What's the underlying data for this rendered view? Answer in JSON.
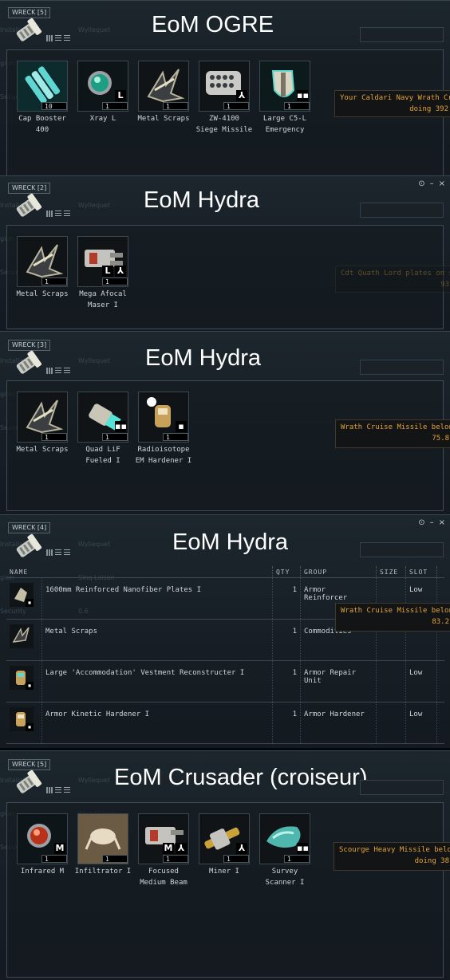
{
  "bg": {
    "l1": "Wyllequet",
    "l2": "Sinq Laison",
    "l3": "0.6",
    "c1": "Installation",
    "c2": "gion",
    "c3": "Security"
  },
  "panels": [
    {
      "wreck_label": "WRECK [5]",
      "title": "EoM OGRE",
      "items": [
        {
          "name": "Cap Booster\n400",
          "qty": "10",
          "icon": "cap-booster-icon"
        },
        {
          "name": "Xray L",
          "qty": "1",
          "badge": "L",
          "icon": "xray-crystal-icon"
        },
        {
          "name": "Metal Scraps",
          "qty": "1",
          "icon": "metal-scraps-icon"
        },
        {
          "name": "ZW-4100\nSiege Missile",
          "qty": "1",
          "badge": "⅄",
          "icon": "siege-launcher-icon"
        },
        {
          "name": "Large C5-L\nEmergency",
          "qty": "1",
          "badge": "▪▪",
          "icon": "emergency-shield-icon"
        }
      ],
      "notification": [
        "Your Caldari Navy Wrath Cru",
        "doing 392"
      ]
    },
    {
      "wreck_label": "WRECK [2]",
      "title": "EoM Hydra",
      "items": [
        {
          "name": "Metal Scraps",
          "qty": "1",
          "icon": "metal-scraps-icon"
        },
        {
          "name": "Mega Afocal\nMaser I",
          "qty": "1",
          "badge": "L",
          "badge2": "⅄",
          "icon": "mega-maser-icon"
        }
      ],
      "notification": [
        "Cdt Quath Lord plates on se",
        "93"
      ]
    },
    {
      "wreck_label": "WRECK [3]",
      "title": "EoM Hydra",
      "items": [
        {
          "name": "Metal Scraps",
          "qty": "1",
          "icon": "metal-scraps-icon"
        },
        {
          "name": "Quad LiF\nFueled I",
          "qty": "1",
          "badge": "▪▪",
          "icon": "booster-thruster-icon"
        },
        {
          "name": "Radioisotope\nEM Hardener I",
          "qty": "1",
          "badge": "▪",
          "icon": "em-hardener-icon"
        }
      ],
      "notification": [
        "Wrath Cruise Missile belongin",
        "75.8"
      ]
    },
    {
      "wreck_label": "WRECK [4]",
      "title": "EoM Hydra",
      "columns": [
        "NAME",
        "QTY",
        "GROUP",
        "SIZE",
        "SLOT"
      ],
      "rows": [
        {
          "name": "1600mm Reinforced Nanofiber Plates I",
          "qty": "1",
          "group": "Armor Reinforcer",
          "size": "",
          "slot": "Low"
        },
        {
          "name": "Metal Scraps",
          "qty": "1",
          "group": "Commodities",
          "size": "",
          "slot": ""
        },
        {
          "name": "Large 'Accommodation' Vestment Reconstructer I",
          "qty": "1",
          "group": "Armor Repair Unit",
          "size": "",
          "slot": "Low"
        },
        {
          "name": "Armor Kinetic Hardener I",
          "qty": "1",
          "group": "Armor Hardener",
          "size": "",
          "slot": "Low"
        }
      ],
      "notification": [
        "Wrath Cruise Missile belongin",
        "83.2"
      ]
    },
    {
      "wreck_label": "WRECK [5]",
      "title": "EoM Crusader (croiseur)",
      "items": [
        {
          "name": "Infrared M",
          "qty": "1",
          "badge": "M",
          "icon": "infrared-crystal-icon"
        },
        {
          "name": "Infiltrator I",
          "qty": "1",
          "icon": "drone-icon"
        },
        {
          "name": "Focused\nMedium Beam",
          "qty": "1",
          "badge": "M",
          "badge2": "⅄",
          "icon": "beam-laser-icon"
        },
        {
          "name": "Miner I",
          "qty": "1",
          "badge": "⅄",
          "icon": "miner-icon"
        },
        {
          "name": "Survey\nScanner I",
          "qty": "1",
          "badge": "▪▪",
          "icon": "survey-scanner-icon"
        }
      ],
      "notification": [
        "Scourge Heavy Missile belon",
        "doing 38"
      ]
    }
  ],
  "window_controls": {
    "settings": "⊙",
    "minimize": "–",
    "close": "×"
  },
  "colors": {
    "title": "#ffffff",
    "notification": "#e3a43a",
    "panel_bg": "#1a232a"
  }
}
